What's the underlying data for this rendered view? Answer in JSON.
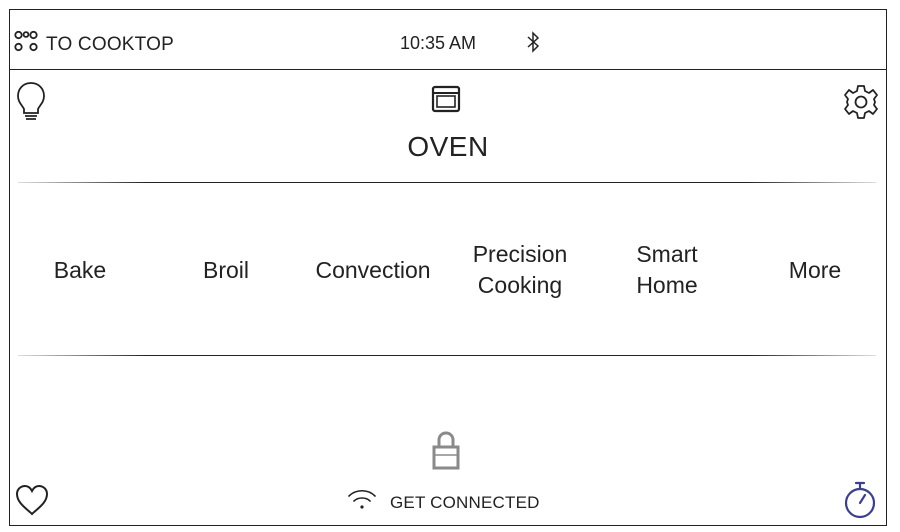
{
  "topbar": {
    "cooktop_label": "TO COOKTOP",
    "time": "10:35 AM",
    "bluetooth_icon": "bluetooth-icon"
  },
  "header": {
    "light_icon": "lightbulb-icon",
    "oven_icon": "oven-icon",
    "title": "OVEN",
    "settings_icon": "gear-icon"
  },
  "modes": [
    {
      "label": "Bake"
    },
    {
      "label": "Broil"
    },
    {
      "label": "Convection"
    },
    {
      "label": "Precision\nCooking"
    },
    {
      "label": "Smart\nHome"
    },
    {
      "label": "More"
    }
  ],
  "footer": {
    "lock_icon": "lock-icon",
    "favorites_icon": "heart-icon",
    "connect_label": "GET CONNECTED",
    "wifi_icon": "wifi-icon",
    "timer_icon": "timer-icon"
  },
  "colors": {
    "foreground": "#222222",
    "timer_accent": "#3a3f8f",
    "lock_gray": "#8a8a8a"
  }
}
